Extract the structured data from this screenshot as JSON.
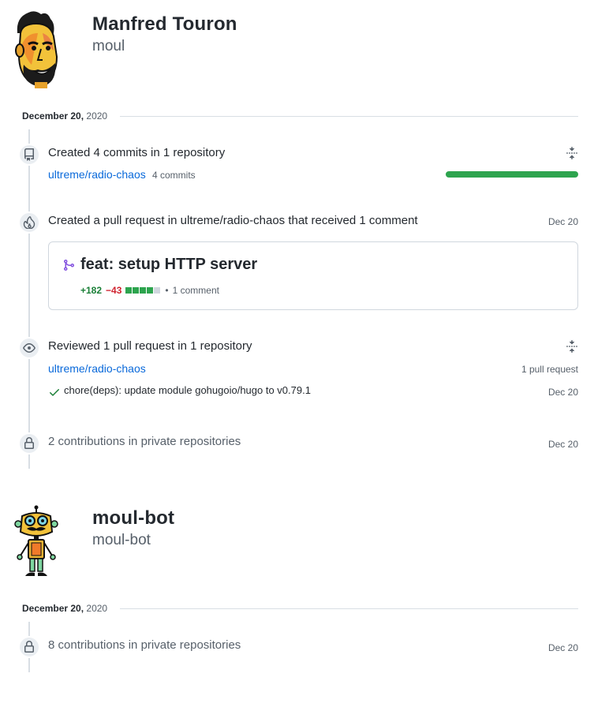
{
  "users": [
    {
      "name": "Manfred Touron",
      "login": "moul",
      "sections": [
        {
          "date": {
            "day": "December 20,",
            "year": "2020"
          },
          "activities": [
            {
              "type": "commits",
              "title": "Created 4 commits in 1 repository",
              "repo": "ultreme/radio-chaos",
              "count": "4 commits",
              "commit_share": 1.0
            },
            {
              "type": "pull-request",
              "title": "Created a pull request in ultreme/radio-chaos that received 1 comment",
              "date": "Dec 20",
              "pr": {
                "title": "feat: setup HTTP server",
                "additions": "+182",
                "deletions": "−43",
                "diff_squares": 4,
                "comments": "1 comment"
              }
            },
            {
              "type": "reviews",
              "title": "Reviewed 1 pull request in 1 repository",
              "repo": "ultreme/radio-chaos",
              "count": "1 pull request",
              "item": {
                "title": "chore(deps): update module gohugoio/hugo to v0.79.1",
                "date": "Dec 20"
              }
            },
            {
              "type": "private",
              "title": "2 contributions in private repositories",
              "date": "Dec 20"
            }
          ]
        }
      ]
    },
    {
      "name": "moul-bot",
      "login": "moul-bot",
      "sections": [
        {
          "date": {
            "day": "December 20,",
            "year": "2020"
          },
          "activities": [
            {
              "type": "private",
              "title": "8 contributions in private repositories",
              "date": "Dec 20"
            }
          ]
        }
      ]
    }
  ],
  "icons": {
    "commits": "repo-push-icon",
    "pull-request": "flame-icon",
    "reviews": "eye-icon",
    "private": "lock-icon",
    "fold": "fold-icon",
    "merged": "git-merge-icon",
    "check": "check-icon"
  },
  "colors": {
    "link": "#0969da",
    "merged": "#8250df",
    "success": "#1a7f37",
    "danger": "#cf222e",
    "progress": "#2da44e"
  }
}
